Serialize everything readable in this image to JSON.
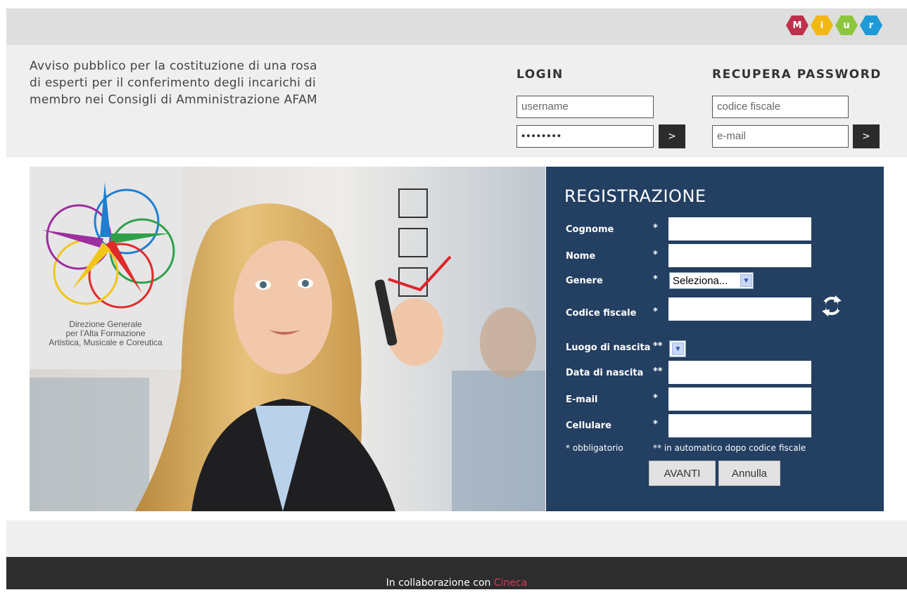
{
  "brand": {
    "logo_letters": [
      "M",
      "i",
      "u",
      "r"
    ],
    "logo_colors": [
      "#c0304a",
      "#f2b712",
      "#8cc63e",
      "#1e9ad6"
    ]
  },
  "notice": {
    "text": "Avviso pubblico per la costituzione di una rosa di esperti per il conferimento degli incarichi di membro nei Consigli di Amministrazione AFAM"
  },
  "login": {
    "title": "LOGIN",
    "username_placeholder": "username",
    "password_mask": "••••••••",
    "submit_label": ">"
  },
  "recover": {
    "title": "RECUPERA PASSWORD",
    "codice_placeholder": "codice fiscale",
    "email_placeholder": "e-mail",
    "submit_label": ">"
  },
  "dg_logo": {
    "caption_line1": "Direzione Generale",
    "caption_line2": "per l'Alta Formazione",
    "caption_line3": "Artistica, Musicale e Coreutica"
  },
  "registration": {
    "title": "REGISTRAZIONE",
    "fields": {
      "cognome": "Cognome",
      "nome": "Nome",
      "genere": "Genere",
      "codice_fiscale": "Codice fiscale",
      "luogo_nascita": "Luogo di nascita",
      "data_nascita": "Data di nascita",
      "email": "E-mail",
      "cellulare": "Cellulare"
    },
    "required_single": "*",
    "required_double": "**",
    "genere_selected": "Seleziona...",
    "note_required": "* obbligatorio",
    "note_auto": "** in automatico dopo codice fiscale",
    "avanti_label": "AVANTI",
    "annulla_label": "Annulla"
  },
  "footer": {
    "text": "In collaborazione con",
    "brand": "Cineca"
  },
  "colors": {
    "registration_bg": "#233f61",
    "footer_bg": "#2d2d2d",
    "footer_brand": "#d63a5a"
  }
}
